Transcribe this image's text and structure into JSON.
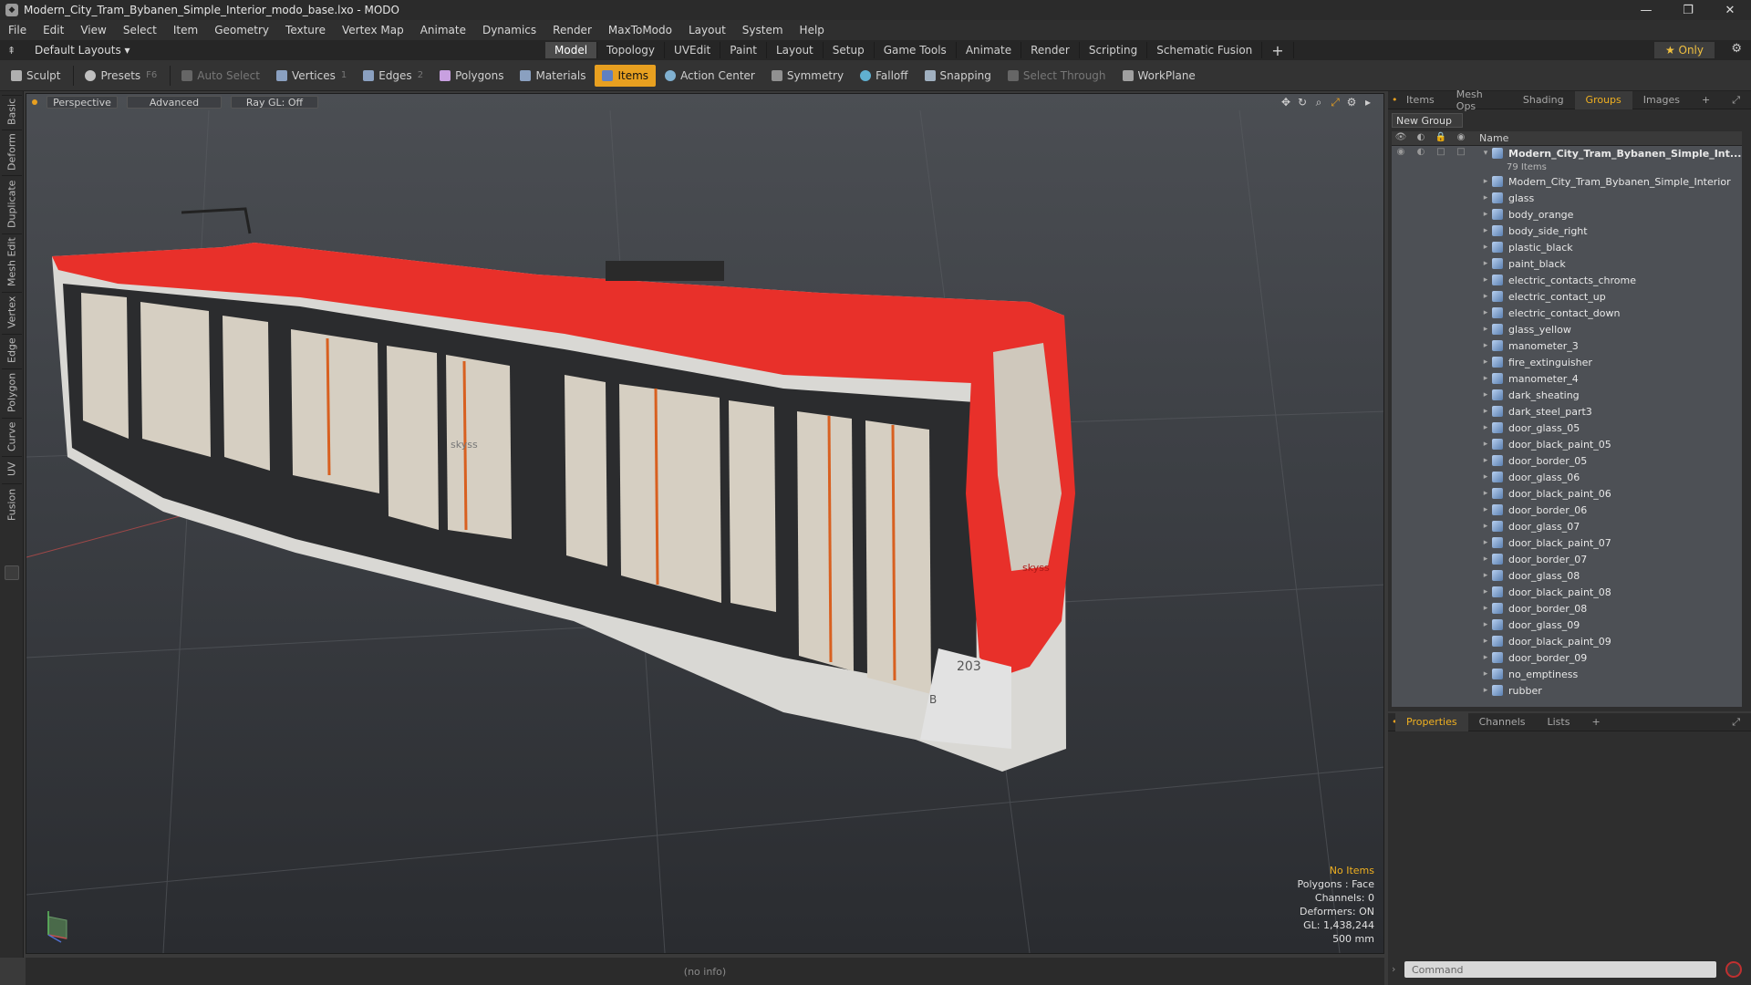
{
  "window": {
    "title": "Modern_City_Tram_Bybanen_Simple_Interior_modo_base.lxo - MODO",
    "controls": [
      "—",
      "❐",
      "✕"
    ]
  },
  "menu": [
    "File",
    "Edit",
    "View",
    "Select",
    "Item",
    "Geometry",
    "Texture",
    "Vertex Map",
    "Animate",
    "Dynamics",
    "Render",
    "MaxToModo",
    "Layout",
    "System",
    "Help"
  ],
  "layoutbar": {
    "preset": "Default Layouts ▾",
    "tabs": [
      "Model",
      "Topology",
      "UVEdit",
      "Paint",
      "Layout",
      "Setup",
      "Game Tools",
      "Animate",
      "Render",
      "Scripting",
      "Schematic Fusion"
    ],
    "active_tab": "Model",
    "add": "+",
    "only": "★ Only"
  },
  "toolbar": {
    "sculpt": "Sculpt",
    "presets": "Presets",
    "presets_key": "F6",
    "auto_select": "Auto Select",
    "vertices": "Vertices",
    "vertices_key": "1",
    "edges": "Edges",
    "edges_key": "2",
    "polygons": "Polygons",
    "materials": "Materials",
    "items": "Items",
    "action_center": "Action Center",
    "symmetry": "Symmetry",
    "falloff": "Falloff",
    "snapping": "Snapping",
    "select_through": "Select Through",
    "workplane": "WorkPlane"
  },
  "left_tabs": [
    "Basic",
    "Deform",
    "Duplicate",
    "Mesh Edit",
    "Vertex",
    "Edge",
    "Polygon",
    "Curve",
    "UV",
    "Fusion"
  ],
  "viewport": {
    "buttons": [
      "Perspective",
      "Advanced",
      "Ray GL: Off"
    ],
    "info": {
      "selection": "No Items",
      "polygons": "Polygons : Face",
      "channels": "Channels: 0",
      "deformers": "Deformers: ON",
      "gl": "GL: 1,438,244",
      "scale": "500 mm"
    },
    "tram": {
      "number": "203",
      "brand": "skyss",
      "letter": "B"
    }
  },
  "statusbar": "(no info)",
  "right_panel": {
    "tabs": [
      "Items",
      "Mesh Ops",
      "Shading",
      "Groups",
      "Images"
    ],
    "active_tab": "Groups",
    "new_group": "New Group",
    "column_name": "Name",
    "group_name": "Modern_City_Tram_Bybanen_Simple_Int...",
    "group_count": "79 Items",
    "items": [
      "Modern_City_Tram_Bybanen_Simple_Interior",
      "glass",
      "body_orange",
      "body_side_right",
      "plastic_black",
      "paint_black",
      "electric_contacts_chrome",
      "electric_contact_up",
      "electric_contact_down",
      "glass_yellow",
      "manometer_3",
      "fire_extinguisher",
      "manometer_4",
      "dark_sheating",
      "dark_steel_part3",
      "door_glass_05",
      "door_black_paint_05",
      "door_border_05",
      "door_glass_06",
      "door_black_paint_06",
      "door_border_06",
      "door_glass_07",
      "door_black_paint_07",
      "door_border_07",
      "door_glass_08",
      "door_black_paint_08",
      "door_border_08",
      "door_glass_09",
      "door_black_paint_09",
      "door_border_09",
      "no_emptiness",
      "rubber"
    ]
  },
  "props_panel": {
    "tabs": [
      "Properties",
      "Channels",
      "Lists"
    ],
    "active_tab": "Properties",
    "command_placeholder": "Command"
  },
  "colors": {
    "accent": "#e8a020",
    "tram_red": "#e8302a",
    "viewport_bg": "#3c3f44"
  }
}
